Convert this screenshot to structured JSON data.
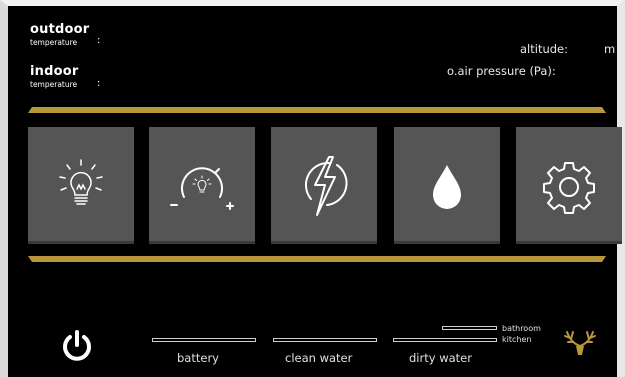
{
  "header": {
    "outdoor_label": "outdoor",
    "outdoor_sub": "temperature",
    "indoor_label": "indoor",
    "indoor_sub": "temperature",
    "colon": ":",
    "altitude_label": "altitude:",
    "altitude_unit": "m",
    "pressure_label": "o.air pressure (Pa):"
  },
  "tiles": [
    {
      "name": "lights-tile",
      "icon": "light-bulb-icon"
    },
    {
      "name": "dimmer-tile",
      "icon": "dimmer-dial-icon"
    },
    {
      "name": "power-tile",
      "icon": "lightning-icon"
    },
    {
      "name": "water-tile",
      "icon": "water-drop-icon"
    },
    {
      "name": "settings-tile",
      "icon": "gear-icon"
    }
  ],
  "gauges": {
    "battery": "battery",
    "clean_water": "clean water",
    "dirty_water": "dirty water",
    "bathroom": "bathroom",
    "kitchen": "kitchen"
  },
  "colors": {
    "background": "#000000",
    "tile": "#555555",
    "accent_gold": "#b8963a",
    "text": "#ffffff"
  }
}
